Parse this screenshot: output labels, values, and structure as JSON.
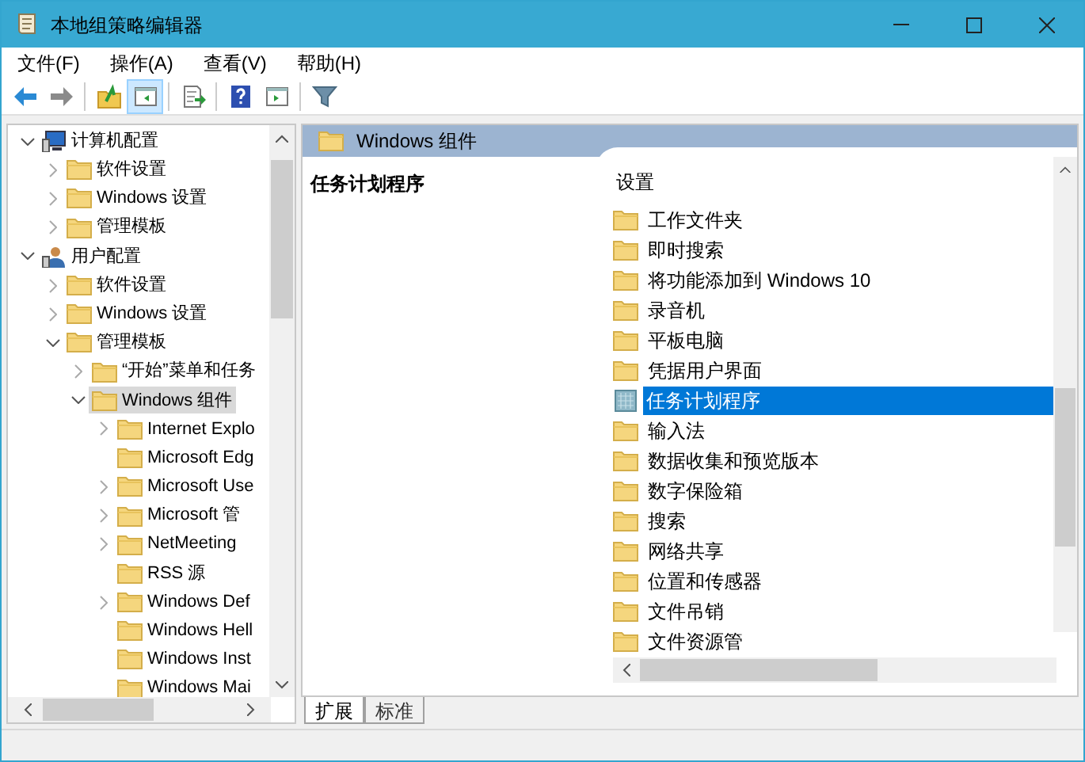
{
  "window": {
    "title": "本地组策略编辑器"
  },
  "menu": [
    "文件(F)",
    "操作(A)",
    "查看(V)",
    "帮助(H)"
  ],
  "toolbar": [
    [
      {
        "kind": "back",
        "on": false
      },
      {
        "kind": "forward",
        "on": false
      }
    ],
    [
      {
        "kind": "up",
        "on": false
      },
      {
        "kind": "console-tree",
        "on": true
      }
    ],
    [
      {
        "kind": "export",
        "on": false
      }
    ],
    [
      {
        "kind": "help",
        "on": false
      },
      {
        "kind": "action-pane",
        "on": false
      }
    ],
    [
      {
        "kind": "filter",
        "on": false
      }
    ]
  ],
  "tree": [
    {
      "label": "计算机配置",
      "kind": "computer",
      "expanded": true,
      "selected": false,
      "children": [
        {
          "label": "软件设置",
          "kind": "folder",
          "expanded": false,
          "selected": false
        },
        {
          "label": "Windows 设置",
          "kind": "folder",
          "expanded": false,
          "selected": false
        },
        {
          "label": "管理模板",
          "kind": "folder",
          "expanded": false,
          "selected": false
        }
      ]
    },
    {
      "label": "用户配置",
      "kind": "user",
      "expanded": true,
      "selected": false,
      "children": [
        {
          "label": "软件设置",
          "kind": "folder",
          "expanded": false,
          "selected": false
        },
        {
          "label": "Windows 设置",
          "kind": "folder",
          "expanded": false,
          "selected": false
        },
        {
          "label": "管理模板",
          "kind": "folder",
          "expanded": true,
          "selected": false,
          "children": [
            {
              "label": "“开始”菜单和任务",
              "kind": "folder",
              "expanded": false,
              "selected": false
            },
            {
              "label": "Windows 组件",
              "kind": "folder",
              "expanded": true,
              "selected": true,
              "children": [
                {
                  "label": "Internet Explo",
                  "kind": "folder",
                  "expanded": false,
                  "selected": false
                },
                {
                  "label": "Microsoft Edg",
                  "kind": "folder",
                  "selected": false
                },
                {
                  "label": "Microsoft Use",
                  "kind": "folder",
                  "expanded": false,
                  "selected": false
                },
                {
                  "label": "Microsoft 管",
                  "kind": "folder",
                  "expanded": false,
                  "selected": false
                },
                {
                  "label": "NetMeeting",
                  "kind": "folder",
                  "expanded": false,
                  "selected": false
                },
                {
                  "label": "RSS 源",
                  "kind": "folder",
                  "selected": false
                },
                {
                  "label": "Windows Def",
                  "kind": "folder",
                  "expanded": false,
                  "selected": false
                },
                {
                  "label": "Windows Hell",
                  "kind": "folder",
                  "selected": false
                },
                {
                  "label": "Windows Inst",
                  "kind": "folder",
                  "selected": false
                },
                {
                  "label": "Windows Mai",
                  "kind": "folder",
                  "selected": false
                }
              ]
            }
          ]
        }
      ]
    }
  ],
  "panel": {
    "header": "Windows 组件",
    "description_title": "任务计划程序",
    "list_header": "设置",
    "items": [
      {
        "label": "工作文件夹",
        "kind": "folder",
        "selected": false
      },
      {
        "label": "即时搜索",
        "kind": "folder",
        "selected": false
      },
      {
        "label": "将功能添加到 Windows 10",
        "kind": "folder",
        "selected": false
      },
      {
        "label": "录音机",
        "kind": "folder",
        "selected": false
      },
      {
        "label": "平板电脑",
        "kind": "folder",
        "selected": false
      },
      {
        "label": "凭据用户界面",
        "kind": "folder",
        "selected": false
      },
      {
        "label": "任务计划程序",
        "kind": "policy",
        "selected": true
      },
      {
        "label": "输入法",
        "kind": "folder",
        "selected": false
      },
      {
        "label": "数据收集和预览版本",
        "kind": "folder",
        "selected": false
      },
      {
        "label": "数字保险箱",
        "kind": "folder",
        "selected": false
      },
      {
        "label": "搜索",
        "kind": "folder",
        "selected": false
      },
      {
        "label": "网络共享",
        "kind": "folder",
        "selected": false
      },
      {
        "label": "位置和传感器",
        "kind": "folder",
        "selected": false
      },
      {
        "label": "文件吊销",
        "kind": "folder",
        "selected": false
      },
      {
        "label": "文件资源管",
        "kind": "folder",
        "selected": false
      }
    ]
  },
  "tabs": [
    {
      "label": "扩展",
      "selected": true
    },
    {
      "label": "标准",
      "selected": false
    }
  ]
}
